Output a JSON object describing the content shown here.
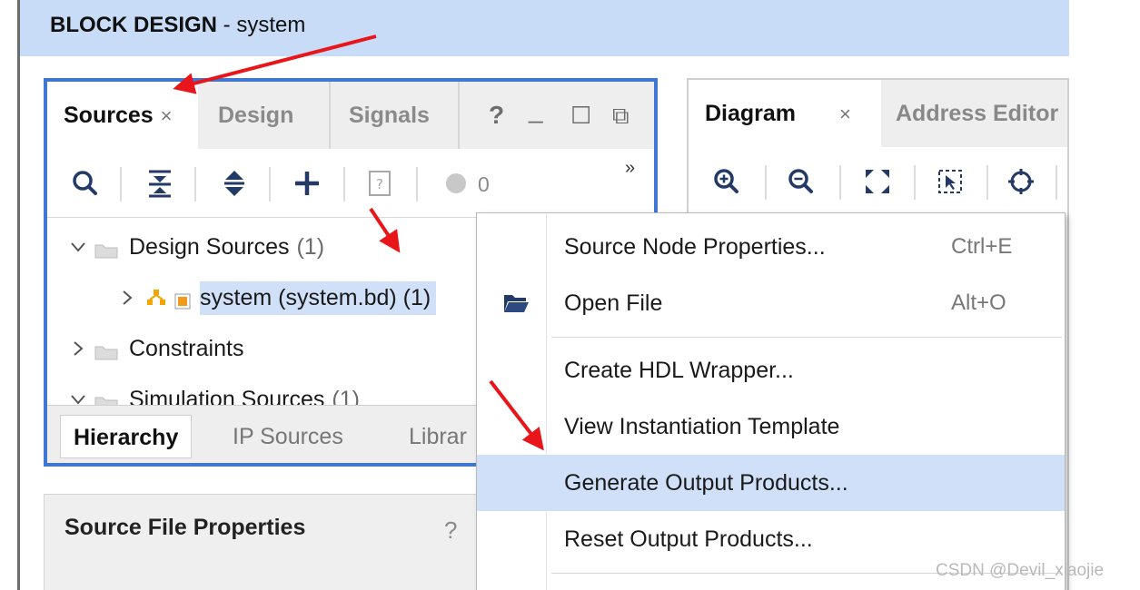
{
  "header": {
    "title_bold": "BLOCK DESIGN",
    "title_rest": " - system"
  },
  "sources_panel": {
    "tabs": [
      {
        "label": "Sources",
        "close": "×"
      },
      {
        "label": "Design"
      },
      {
        "label": "Signals"
      }
    ],
    "window_controls": {
      "help": "?",
      "minimize": "_",
      "maximize": "☐",
      "float": "⧉"
    },
    "toolbar": {
      "overflow": "»",
      "error_count": "0"
    },
    "tree": [
      {
        "label": "Design Sources",
        "count": "(1)",
        "expanded": true
      },
      {
        "label": "system (system.bd) (1)",
        "selected": true
      },
      {
        "label": "Constraints",
        "expanded": false
      },
      {
        "label": "Simulation Sources",
        "count": "(1)",
        "expanded": true
      }
    ],
    "bottom_tabs": [
      "Hierarchy",
      "IP Sources",
      "Librar"
    ]
  },
  "props_panel": {
    "title": "Source File Properties",
    "help": "?"
  },
  "diagram_panel": {
    "tabs": [
      {
        "label": "Diagram",
        "close": "×"
      },
      {
        "label": "Address Editor"
      }
    ]
  },
  "context_menu": {
    "items": [
      {
        "label": "Source Node Properties...",
        "shortcut": "Ctrl+E"
      },
      {
        "label": "Open File",
        "shortcut": "Alt+O",
        "icon": "open-folder-icon"
      },
      {
        "label": "Create HDL Wrapper..."
      },
      {
        "label": "View Instantiation Template"
      },
      {
        "label": "Generate Output Products...",
        "highlighted": true
      },
      {
        "label": "Reset Output Products..."
      }
    ]
  },
  "watermark": "CSDN @Devil_xiaojie",
  "colors": {
    "header_bg": "#c9dcf7",
    "panel_border": "#3f78d2",
    "selection": "#cfe0f8",
    "annotation_arrow": "#e8161b"
  }
}
